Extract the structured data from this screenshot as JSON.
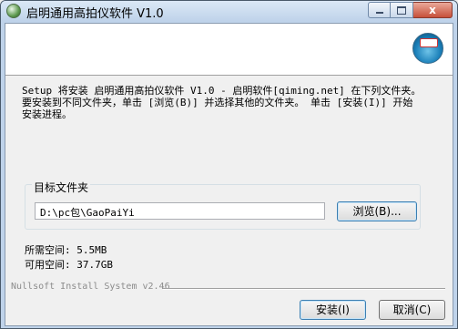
{
  "window": {
    "title": "启明通用高拍仪软件 V1.0",
    "close_glyph": "x"
  },
  "header": {
    "icon": "installer-cd-icon"
  },
  "description": "Setup 将安装 启明通用高拍仪软件 V1.0 - 启明软件[qiming.net] 在下列文件夹。\n要安装到不同文件夹，单击 [浏览(B)] 并选择其他的文件夹。 单击 [安装(I)] 开始\n安装进程。",
  "destination": {
    "group_label": "目标文件夹",
    "path_value": "D:\\pc包\\GaoPaiYi",
    "browse_label": "浏览(B)..."
  },
  "space": {
    "required": "所需空间: 5.5MB",
    "available": "可用空间: 37.7GB"
  },
  "branding": "Nullsoft Install System v2.46",
  "buttons": {
    "install_label": "安装(I)",
    "cancel_label": "取消(C)"
  }
}
